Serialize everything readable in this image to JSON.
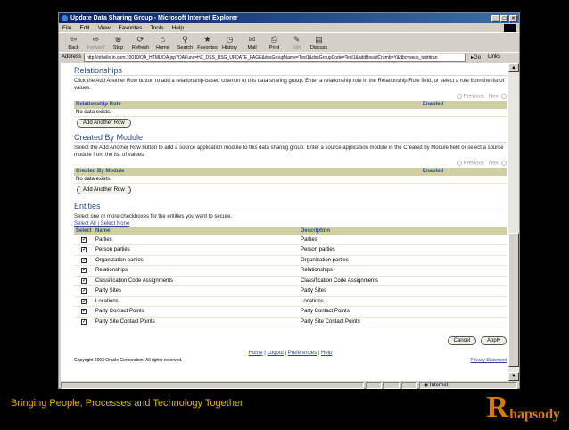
{
  "window": {
    "title": "Update Data Sharing Group - Microsoft Internet Explorer",
    "controls": [
      "_",
      "□",
      "×"
    ]
  },
  "menu": [
    "File",
    "Edit",
    "View",
    "Favorites",
    "Tools",
    "Help"
  ],
  "toolbar": [
    {
      "label": "Back",
      "icon": "back-arrow-icon"
    },
    {
      "label": "Forward",
      "icon": "forward-arrow-icon"
    },
    {
      "label": "Stop",
      "icon": "stop-icon"
    },
    {
      "label": "Refresh",
      "icon": "refresh-icon"
    },
    {
      "label": "Home",
      "icon": "home-icon"
    },
    {
      "label": "Search",
      "icon": "search-icon"
    },
    {
      "label": "Favorites",
      "icon": "favorites-icon"
    },
    {
      "label": "History",
      "icon": "history-icon"
    },
    {
      "label": "Mail",
      "icon": "mail-icon"
    },
    {
      "label": "Print",
      "icon": "print-icon"
    },
    {
      "label": "Edit",
      "icon": "edit-icon"
    },
    {
      "label": "Discuss",
      "icon": "discuss-icon"
    }
  ],
  "address": {
    "label": "Address",
    "url": "http://othello.in.com:10010/OA_HTML/OA.jsp?OAFunc=HZ_DSS_DSG_UPDATE_PAGE&dssGroupName=Test1&dssGroupCode=Test1&addBreadCrumb=Y&dbc=seus_testttran",
    "go": "Go",
    "links": "Links"
  },
  "relationships": {
    "title": "Relationships",
    "desc": "Click the Add Another Row button to add a relationship-based criterion to this data sharing group. Enter a relationship role in the Relationship Role field, or select a role from the list of values.",
    "pager_prev": "Previous",
    "pager_next": "Next",
    "col1": "Relationship Role",
    "col2": "Enabled",
    "empty": "No data exists.",
    "button": "Add Another Row"
  },
  "created_by": {
    "title": "Created By Module",
    "desc": "Select the Add Another Row button to add a source application module to this data sharing group. Enter a source application module in the Created by Module field or select a source module from the list of values.",
    "pager_prev": "Previous",
    "pager_next": "Next",
    "col1": "Created By Module",
    "col2": "Enabled",
    "empty": "No data exists.",
    "button": "Add Another Row"
  },
  "entities": {
    "title": "Entities",
    "desc": "Select one or more checkboxes for the entities you want to secure.",
    "select_all": "Select All",
    "separator": "|",
    "select_none": "Select None",
    "col_select": "Select",
    "col_name": "Name",
    "col_desc": "Description",
    "rows": [
      {
        "name": "Parties",
        "desc": "Parties"
      },
      {
        "name": "Person parties",
        "desc": "Person parties"
      },
      {
        "name": "Organization parties",
        "desc": "Organization parties"
      },
      {
        "name": "Relationships",
        "desc": "Relationships"
      },
      {
        "name": "Classification Code Assignments",
        "desc": "Classification Code Assignments"
      },
      {
        "name": "Party Sites",
        "desc": "Party Sites"
      },
      {
        "name": "Locations",
        "desc": "Locations"
      },
      {
        "name": "Party Contact Points",
        "desc": "Party Contact Points"
      },
      {
        "name": "Party Site Contact Points",
        "desc": "Party Site Contact Points"
      }
    ]
  },
  "actions": {
    "cancel": "Cancel",
    "apply": "Apply"
  },
  "footer_links": [
    "Home",
    "Logout",
    "Preferences",
    "Help"
  ],
  "copyright": "Copyright 2003 Oracle Corporation. All rights reserved.",
  "privacy": "Privacy Statement",
  "status": {
    "zone": "Internet"
  },
  "slide": {
    "tagline": "Bringing People, Processes and Technology Together",
    "logo_initial": "R",
    "logo_rest": "hapsody"
  }
}
